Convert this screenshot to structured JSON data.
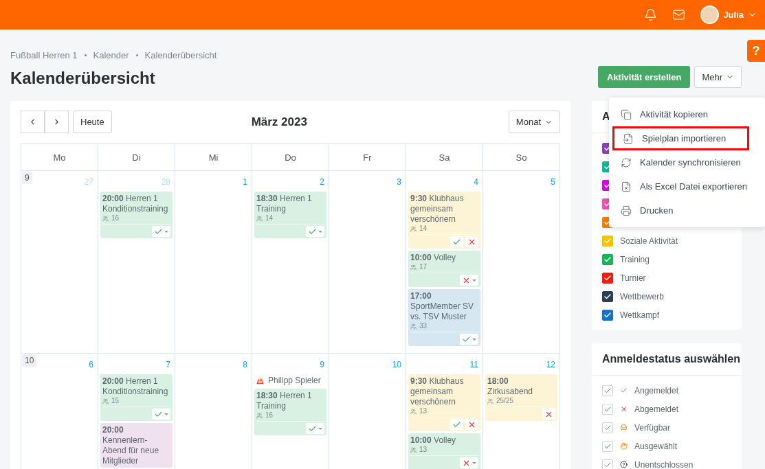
{
  "topbar": {
    "user": "Julia"
  },
  "help": "?",
  "breadcrumb": [
    "Fußball Herren 1",
    "Kalender",
    "Kalenderübersicht"
  ],
  "title": "Kalenderübersicht",
  "actions": {
    "primary": "Aktivität erstellen",
    "more": "Mehr"
  },
  "more_menu": [
    {
      "label": "Aktivität kopieren",
      "kind": "copy",
      "highlighted": false
    },
    {
      "label": "Spielplan importieren",
      "kind": "import",
      "highlighted": true
    },
    {
      "label": "Kalender synchronisieren",
      "kind": "sync",
      "highlighted": false
    },
    {
      "label": "Als Excel Datei exportieren",
      "kind": "excel",
      "highlighted": false
    },
    {
      "label": "Drucken",
      "kind": "print",
      "highlighted": false
    }
  ],
  "calendar": {
    "today": "Heute",
    "month": "März 2023",
    "view": "Monat",
    "weekdays": [
      "Mo",
      "Di",
      "Mi",
      "Do",
      "Fr",
      "Sa",
      "So"
    ],
    "weeks": [
      {
        "number": "9",
        "days": [
          {
            "day": "27",
            "muted": true
          },
          {
            "day": "28",
            "muted": true,
            "entries": [
              {
                "kind": "event",
                "time": "20:00",
                "title": "Herren 1 Konditionstraining",
                "count": "16",
                "color": "#d8f1e3",
                "actions": [
                  {
                    "kind": "accept"
                  }
                ],
                "menu": true
              }
            ]
          },
          {
            "day": "1",
            "muted": false
          },
          {
            "day": "2",
            "muted": false,
            "entries": [
              {
                "kind": "event",
                "time": "18:30",
                "title": "Herren 1 Training",
                "count": "14",
                "color": "#d8f1e3",
                "actions": [
                  {
                    "kind": "accept"
                  }
                ],
                "menu": true
              }
            ]
          },
          {
            "day": "3",
            "muted": false
          },
          {
            "day": "4",
            "muted": false,
            "entries": [
              {
                "kind": "event",
                "time": "9:30",
                "title": "Klubhaus gemeinsam verschönern",
                "count": "14",
                "color": "#fdf4d6",
                "actions": [
                  {
                    "kind": "accept"
                  },
                  {
                    "kind": "decline"
                  }
                ],
                "menu": false
              },
              {
                "kind": "event",
                "time": "10:00",
                "title": "Volley",
                "count": "17",
                "color": "#d8f1e3",
                "actions": [
                  {
                    "kind": "decline"
                  }
                ],
                "menu": true
              },
              {
                "kind": "event",
                "time": "17:00",
                "title": "SportMember SV vs. TSV Muster",
                "count": "33",
                "color": "#d7e7f2",
                "actions": [
                  {
                    "kind": "accept"
                  }
                ],
                "menu": true
              }
            ]
          },
          {
            "day": "5",
            "muted": false
          }
        ]
      },
      {
        "number": "10",
        "days": [
          {
            "day": "6",
            "muted": false
          },
          {
            "day": "7",
            "muted": false,
            "entries": [
              {
                "kind": "event",
                "time": "20:00",
                "title": "Herren 1 Konditionstraining",
                "count": "15",
                "color": "#d8f1e3",
                "actions": [
                  {
                    "kind": "accept"
                  }
                ],
                "menu": true
              },
              {
                "kind": "event",
                "time": "20:00",
                "title": "Kennenlern-Abend für neue Mitglieder",
                "color": "#efe1ef"
              }
            ]
          },
          {
            "day": "8",
            "muted": false
          },
          {
            "day": "9",
            "muted": false,
            "entries": [
              {
                "kind": "birthday",
                "title": "Philipp Spieler"
              },
              {
                "kind": "event",
                "time": "18:30",
                "title": "Herren 1 Training",
                "count": "16",
                "color": "#d8f1e3",
                "actions": [
                  {
                    "kind": "accept"
                  }
                ],
                "menu": true
              }
            ]
          },
          {
            "day": "10",
            "muted": false
          },
          {
            "day": "11",
            "muted": false,
            "entries": [
              {
                "kind": "event",
                "time": "9:30",
                "title": "Klubhaus gemeinsam verschönern",
                "count": "13",
                "color": "#fdf4d6",
                "actions": [
                  {
                    "kind": "accept"
                  },
                  {
                    "kind": "decline"
                  }
                ],
                "menu": false
              },
              {
                "kind": "event",
                "time": "10:00",
                "title": "Volley",
                "count": "13",
                "color": "#d8f1e3",
                "actions": [
                  {
                    "kind": "decline"
                  }
                ],
                "menu": true
              }
            ]
          },
          {
            "day": "12",
            "muted": false,
            "entries": [
              {
                "kind": "event",
                "time": "18:00",
                "title": "Zirkusabend",
                "count": "25/25",
                "color": "#fdf4d6",
                "actions": [
                  {
                    "kind": "decline"
                  }
                ],
                "menu": false
              }
            ]
          }
        ]
      }
    ]
  },
  "categories": {
    "title": "A",
    "items": [
      {
        "color": "#8e44ad",
        "checked": true
      },
      {
        "color": "#16b79a",
        "checked": true
      },
      {
        "color": "#d010e0",
        "checked": true
      },
      {
        "color": "#f04fb4",
        "checked": true
      },
      {
        "color": "#f08010",
        "checked": true
      },
      {
        "label": "Soziale Aktivität",
        "color": "#f5c400",
        "checked": true
      },
      {
        "label": "Training",
        "color": "#18b45a",
        "checked": true
      },
      {
        "label": "Turnier",
        "color": "#f01c10",
        "checked": true
      },
      {
        "label": "Wettbewerb",
        "color": "#2c3e55",
        "checked": true
      },
      {
        "label": "Wettkampf",
        "color": "#1473c8",
        "checked": true
      }
    ]
  },
  "status_filter": {
    "title": "Anmeldestatus auswählen",
    "items": [
      {
        "label": "Angemeldet",
        "kind": "accepted",
        "checked": true
      },
      {
        "label": "Abgemeldet",
        "kind": "declined",
        "checked": true
      },
      {
        "label": "Verfügbar",
        "kind": "available",
        "checked": true
      },
      {
        "label": "Ausgewählt",
        "kind": "selected",
        "checked": true
      },
      {
        "label": "Unentschlossen",
        "kind": "undecided",
        "checked": true
      }
    ]
  }
}
